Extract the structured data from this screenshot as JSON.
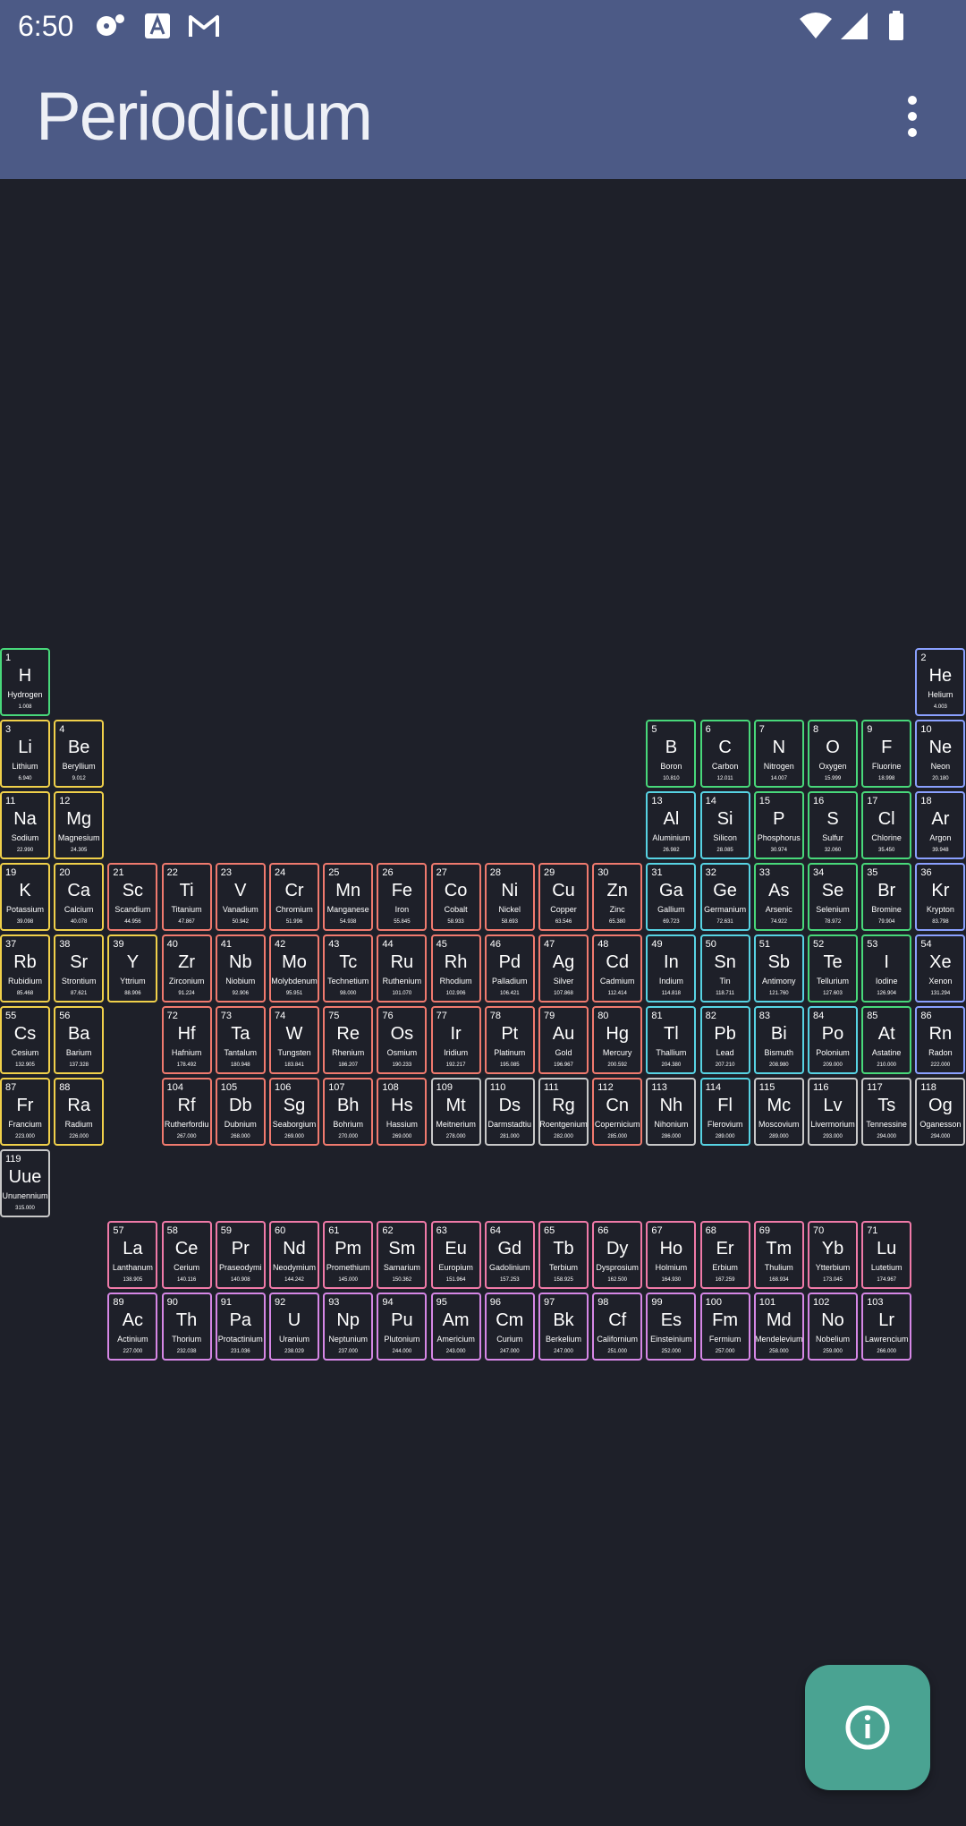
{
  "status_bar": {
    "time": "6:50"
  },
  "app_bar": {
    "title": "Periodicium"
  },
  "colors": {
    "alkali": "#f0d04a",
    "transition": "#f07a6e",
    "unknown": "#c8c8c8",
    "post_transition": "#57d3e3",
    "nonmetal": "#48d87a",
    "noble_gas": "#8aa0ff",
    "lanthanide": "#f07aa8",
    "actinide": "#d687e6"
  },
  "elements": [
    {
      "n": "1",
      "s": "H",
      "name": "Hydrogen",
      "m": "1.008",
      "c": "nonmetal",
      "r": 1,
      "col": 1
    },
    {
      "n": "2",
      "s": "He",
      "name": "Helium",
      "m": "4.003",
      "c": "noble_gas",
      "r": 1,
      "col": 18
    },
    {
      "n": "3",
      "s": "Li",
      "name": "Lithium",
      "m": "6.940",
      "c": "alkali",
      "r": 2,
      "col": 1
    },
    {
      "n": "4",
      "s": "Be",
      "name": "Beryllium",
      "m": "9.012",
      "c": "alkali",
      "r": 2,
      "col": 2
    },
    {
      "n": "5",
      "s": "B",
      "name": "Boron",
      "m": "10.810",
      "c": "nonmetal",
      "r": 2,
      "col": 13
    },
    {
      "n": "6",
      "s": "C",
      "name": "Carbon",
      "m": "12.011",
      "c": "nonmetal",
      "r": 2,
      "col": 14
    },
    {
      "n": "7",
      "s": "N",
      "name": "Nitrogen",
      "m": "14.007",
      "c": "nonmetal",
      "r": 2,
      "col": 15
    },
    {
      "n": "8",
      "s": "O",
      "name": "Oxygen",
      "m": "15.999",
      "c": "nonmetal",
      "r": 2,
      "col": 16
    },
    {
      "n": "9",
      "s": "F",
      "name": "Fluorine",
      "m": "18.998",
      "c": "nonmetal",
      "r": 2,
      "col": 17
    },
    {
      "n": "10",
      "s": "Ne",
      "name": "Neon",
      "m": "20.180",
      "c": "noble_gas",
      "r": 2,
      "col": 18
    },
    {
      "n": "11",
      "s": "Na",
      "name": "Sodium",
      "m": "22.990",
      "c": "alkali",
      "r": 3,
      "col": 1
    },
    {
      "n": "12",
      "s": "Mg",
      "name": "Magnesium",
      "m": "24.305",
      "c": "alkali",
      "r": 3,
      "col": 2
    },
    {
      "n": "13",
      "s": "Al",
      "name": "Aluminium",
      "m": "26.982",
      "c": "post_transition",
      "r": 3,
      "col": 13
    },
    {
      "n": "14",
      "s": "Si",
      "name": "Silicon",
      "m": "28.085",
      "c": "post_transition",
      "r": 3,
      "col": 14
    },
    {
      "n": "15",
      "s": "P",
      "name": "Phosphorus",
      "m": "30.974",
      "c": "nonmetal",
      "r": 3,
      "col": 15
    },
    {
      "n": "16",
      "s": "S",
      "name": "Sulfur",
      "m": "32.060",
      "c": "nonmetal",
      "r": 3,
      "col": 16
    },
    {
      "n": "17",
      "s": "Cl",
      "name": "Chlorine",
      "m": "35.450",
      "c": "nonmetal",
      "r": 3,
      "col": 17
    },
    {
      "n": "18",
      "s": "Ar",
      "name": "Argon",
      "m": "39.948",
      "c": "noble_gas",
      "r": 3,
      "col": 18
    },
    {
      "n": "19",
      "s": "K",
      "name": "Potassium",
      "m": "39.098",
      "c": "alkali",
      "r": 4,
      "col": 1
    },
    {
      "n": "20",
      "s": "Ca",
      "name": "Calcium",
      "m": "40.078",
      "c": "alkali",
      "r": 4,
      "col": 2
    },
    {
      "n": "21",
      "s": "Sc",
      "name": "Scandium",
      "m": "44.956",
      "c": "transition",
      "r": 4,
      "col": 3
    },
    {
      "n": "22",
      "s": "Ti",
      "name": "Titanium",
      "m": "47.867",
      "c": "transition",
      "r": 4,
      "col": 4
    },
    {
      "n": "23",
      "s": "V",
      "name": "Vanadium",
      "m": "50.942",
      "c": "transition",
      "r": 4,
      "col": 5
    },
    {
      "n": "24",
      "s": "Cr",
      "name": "Chromium",
      "m": "51.996",
      "c": "transition",
      "r": 4,
      "col": 6
    },
    {
      "n": "25",
      "s": "Mn",
      "name": "Manganese",
      "m": "54.938",
      "c": "transition",
      "r": 4,
      "col": 7
    },
    {
      "n": "26",
      "s": "Fe",
      "name": "Iron",
      "m": "55.845",
      "c": "transition",
      "r": 4,
      "col": 8
    },
    {
      "n": "27",
      "s": "Co",
      "name": "Cobalt",
      "m": "58.933",
      "c": "transition",
      "r": 4,
      "col": 9
    },
    {
      "n": "28",
      "s": "Ni",
      "name": "Nickel",
      "m": "58.693",
      "c": "transition",
      "r": 4,
      "col": 10
    },
    {
      "n": "29",
      "s": "Cu",
      "name": "Copper",
      "m": "63.546",
      "c": "transition",
      "r": 4,
      "col": 11
    },
    {
      "n": "30",
      "s": "Zn",
      "name": "Zinc",
      "m": "65.380",
      "c": "transition",
      "r": 4,
      "col": 12
    },
    {
      "n": "31",
      "s": "Ga",
      "name": "Gallium",
      "m": "69.723",
      "c": "post_transition",
      "r": 4,
      "col": 13
    },
    {
      "n": "32",
      "s": "Ge",
      "name": "Germanium",
      "m": "72.631",
      "c": "post_transition",
      "r": 4,
      "col": 14
    },
    {
      "n": "33",
      "s": "As",
      "name": "Arsenic",
      "m": "74.922",
      "c": "nonmetal",
      "r": 4,
      "col": 15
    },
    {
      "n": "34",
      "s": "Se",
      "name": "Selenium",
      "m": "78.972",
      "c": "nonmetal",
      "r": 4,
      "col": 16
    },
    {
      "n": "35",
      "s": "Br",
      "name": "Bromine",
      "m": "79.904",
      "c": "nonmetal",
      "r": 4,
      "col": 17
    },
    {
      "n": "36",
      "s": "Kr",
      "name": "Krypton",
      "m": "83.798",
      "c": "noble_gas",
      "r": 4,
      "col": 18
    },
    {
      "n": "37",
      "s": "Rb",
      "name": "Rubidium",
      "m": "85.468",
      "c": "alkali",
      "r": 5,
      "col": 1
    },
    {
      "n": "38",
      "s": "Sr",
      "name": "Strontium",
      "m": "87.621",
      "c": "alkali",
      "r": 5,
      "col": 2
    },
    {
      "n": "39",
      "s": "Y",
      "name": "Yttrium",
      "m": "88.906",
      "c": "alkali",
      "r": 5,
      "col": 3
    },
    {
      "n": "40",
      "s": "Zr",
      "name": "Zirconium",
      "m": "91.224",
      "c": "transition",
      "r": 5,
      "col": 4
    },
    {
      "n": "41",
      "s": "Nb",
      "name": "Niobium",
      "m": "92.906",
      "c": "transition",
      "r": 5,
      "col": 5
    },
    {
      "n": "42",
      "s": "Mo",
      "name": "Molybdenum",
      "m": "95.951",
      "c": "transition",
      "r": 5,
      "col": 6
    },
    {
      "n": "43",
      "s": "Tc",
      "name": "Technetium",
      "m": "98.000",
      "c": "transition",
      "r": 5,
      "col": 7
    },
    {
      "n": "44",
      "s": "Ru",
      "name": "Ruthenium",
      "m": "101.070",
      "c": "transition",
      "r": 5,
      "col": 8
    },
    {
      "n": "45",
      "s": "Rh",
      "name": "Rhodium",
      "m": "102.906",
      "c": "transition",
      "r": 5,
      "col": 9
    },
    {
      "n": "46",
      "s": "Pd",
      "name": "Palladium",
      "m": "106.421",
      "c": "transition",
      "r": 5,
      "col": 10
    },
    {
      "n": "47",
      "s": "Ag",
      "name": "Silver",
      "m": "107.868",
      "c": "transition",
      "r": 5,
      "col": 11
    },
    {
      "n": "48",
      "s": "Cd",
      "name": "Cadmium",
      "m": "112.414",
      "c": "transition",
      "r": 5,
      "col": 12
    },
    {
      "n": "49",
      "s": "In",
      "name": "Indium",
      "m": "114.818",
      "c": "post_transition",
      "r": 5,
      "col": 13
    },
    {
      "n": "50",
      "s": "Sn",
      "name": "Tin",
      "m": "118.711",
      "c": "post_transition",
      "r": 5,
      "col": 14
    },
    {
      "n": "51",
      "s": "Sb",
      "name": "Antimony",
      "m": "121.760",
      "c": "post_transition",
      "r": 5,
      "col": 15
    },
    {
      "n": "52",
      "s": "Te",
      "name": "Tellurium",
      "m": "127.603",
      "c": "nonmetal",
      "r": 5,
      "col": 16
    },
    {
      "n": "53",
      "s": "I",
      "name": "Iodine",
      "m": "126.904",
      "c": "nonmetal",
      "r": 5,
      "col": 17
    },
    {
      "n": "54",
      "s": "Xe",
      "name": "Xenon",
      "m": "131.294",
      "c": "noble_gas",
      "r": 5,
      "col": 18
    },
    {
      "n": "55",
      "s": "Cs",
      "name": "Cesium",
      "m": "132.905",
      "c": "alkali",
      "r": 6,
      "col": 1
    },
    {
      "n": "56",
      "s": "Ba",
      "name": "Barium",
      "m": "137.328",
      "c": "alkali",
      "r": 6,
      "col": 2
    },
    {
      "n": "72",
      "s": "Hf",
      "name": "Hafnium",
      "m": "178.492",
      "c": "transition",
      "r": 6,
      "col": 4
    },
    {
      "n": "73",
      "s": "Ta",
      "name": "Tantalum",
      "m": "180.948",
      "c": "transition",
      "r": 6,
      "col": 5
    },
    {
      "n": "74",
      "s": "W",
      "name": "Tungsten",
      "m": "183.841",
      "c": "transition",
      "r": 6,
      "col": 6
    },
    {
      "n": "75",
      "s": "Re",
      "name": "Rhenium",
      "m": "186.207",
      "c": "transition",
      "r": 6,
      "col": 7
    },
    {
      "n": "76",
      "s": "Os",
      "name": "Osmium",
      "m": "190.233",
      "c": "transition",
      "r": 6,
      "col": 8
    },
    {
      "n": "77",
      "s": "Ir",
      "name": "Iridium",
      "m": "192.217",
      "c": "transition",
      "r": 6,
      "col": 9
    },
    {
      "n": "78",
      "s": "Pt",
      "name": "Platinum",
      "m": "195.085",
      "c": "transition",
      "r": 6,
      "col": 10
    },
    {
      "n": "79",
      "s": "Au",
      "name": "Gold",
      "m": "196.967",
      "c": "transition",
      "r": 6,
      "col": 11
    },
    {
      "n": "80",
      "s": "Hg",
      "name": "Mercury",
      "m": "200.592",
      "c": "transition",
      "r": 6,
      "col": 12
    },
    {
      "n": "81",
      "s": "Tl",
      "name": "Thallium",
      "m": "204.380",
      "c": "post_transition",
      "r": 6,
      "col": 13
    },
    {
      "n": "82",
      "s": "Pb",
      "name": "Lead",
      "m": "207.210",
      "c": "post_transition",
      "r": 6,
      "col": 14
    },
    {
      "n": "83",
      "s": "Bi",
      "name": "Bismuth",
      "m": "208.980",
      "c": "post_transition",
      "r": 6,
      "col": 15
    },
    {
      "n": "84",
      "s": "Po",
      "name": "Polonium",
      "m": "209.000",
      "c": "post_transition",
      "r": 6,
      "col": 16
    },
    {
      "n": "85",
      "s": "At",
      "name": "Astatine",
      "m": "210.000",
      "c": "nonmetal",
      "r": 6,
      "col": 17
    },
    {
      "n": "86",
      "s": "Rn",
      "name": "Radon",
      "m": "222.000",
      "c": "noble_gas",
      "r": 6,
      "col": 18
    },
    {
      "n": "87",
      "s": "Fr",
      "name": "Francium",
      "m": "223.000",
      "c": "alkali",
      "r": 7,
      "col": 1
    },
    {
      "n": "88",
      "s": "Ra",
      "name": "Radium",
      "m": "226.000",
      "c": "alkali",
      "r": 7,
      "col": 2
    },
    {
      "n": "104",
      "s": "Rf",
      "name": "Rutherfordiu",
      "m": "267.000",
      "c": "transition",
      "r": 7,
      "col": 4
    },
    {
      "n": "105",
      "s": "Db",
      "name": "Dubnium",
      "m": "268.000",
      "c": "transition",
      "r": 7,
      "col": 5
    },
    {
      "n": "106",
      "s": "Sg",
      "name": "Seaborgium",
      "m": "269.000",
      "c": "transition",
      "r": 7,
      "col": 6
    },
    {
      "n": "107",
      "s": "Bh",
      "name": "Bohrium",
      "m": "270.000",
      "c": "transition",
      "r": 7,
      "col": 7
    },
    {
      "n": "108",
      "s": "Hs",
      "name": "Hassium",
      "m": "269.000",
      "c": "transition",
      "r": 7,
      "col": 8
    },
    {
      "n": "109",
      "s": "Mt",
      "name": "Meitnerium",
      "m": "278.000",
      "c": "unknown",
      "r": 7,
      "col": 9
    },
    {
      "n": "110",
      "s": "Ds",
      "name": "Darmstadtiu",
      "m": "281.000",
      "c": "unknown",
      "r": 7,
      "col": 10
    },
    {
      "n": "111",
      "s": "Rg",
      "name": "Roentgenium",
      "m": "282.000",
      "c": "unknown",
      "r": 7,
      "col": 11
    },
    {
      "n": "112",
      "s": "Cn",
      "name": "Copernicium",
      "m": "285.000",
      "c": "transition",
      "r": 7,
      "col": 12
    },
    {
      "n": "113",
      "s": "Nh",
      "name": "Nihonium",
      "m": "286.000",
      "c": "unknown",
      "r": 7,
      "col": 13
    },
    {
      "n": "114",
      "s": "Fl",
      "name": "Flerovium",
      "m": "289.000",
      "c": "post_transition",
      "r": 7,
      "col": 14
    },
    {
      "n": "115",
      "s": "Mc",
      "name": "Moscovium",
      "m": "289.000",
      "c": "unknown",
      "r": 7,
      "col": 15
    },
    {
      "n": "116",
      "s": "Lv",
      "name": "Livermorium",
      "m": "293.000",
      "c": "unknown",
      "r": 7,
      "col": 16
    },
    {
      "n": "117",
      "s": "Ts",
      "name": "Tennessine",
      "m": "294.000",
      "c": "unknown",
      "r": 7,
      "col": 17
    },
    {
      "n": "118",
      "s": "Og",
      "name": "Oganesson",
      "m": "294.000",
      "c": "unknown",
      "r": 7,
      "col": 18
    },
    {
      "n": "119",
      "s": "Uue",
      "name": "Ununennium",
      "m": "315.000",
      "c": "unknown",
      "r": 8,
      "col": 1
    },
    {
      "n": "57",
      "s": "La",
      "name": "Lanthanum",
      "m": "138.905",
      "c": "lanthanide",
      "r": 9,
      "col": 3
    },
    {
      "n": "58",
      "s": "Ce",
      "name": "Cerium",
      "m": "140.116",
      "c": "lanthanide",
      "r": 9,
      "col": 4
    },
    {
      "n": "59",
      "s": "Pr",
      "name": "Praseodymi",
      "m": "140.908",
      "c": "lanthanide",
      "r": 9,
      "col": 5
    },
    {
      "n": "60",
      "s": "Nd",
      "name": "Neodymium",
      "m": "144.242",
      "c": "lanthanide",
      "r": 9,
      "col": 6
    },
    {
      "n": "61",
      "s": "Pm",
      "name": "Promethium",
      "m": "145.000",
      "c": "lanthanide",
      "r": 9,
      "col": 7
    },
    {
      "n": "62",
      "s": "Sm",
      "name": "Samarium",
      "m": "150.362",
      "c": "lanthanide",
      "r": 9,
      "col": 8
    },
    {
      "n": "63",
      "s": "Eu",
      "name": "Europium",
      "m": "151.964",
      "c": "lanthanide",
      "r": 9,
      "col": 9
    },
    {
      "n": "64",
      "s": "Gd",
      "name": "Gadolinium",
      "m": "157.253",
      "c": "lanthanide",
      "r": 9,
      "col": 10
    },
    {
      "n": "65",
      "s": "Tb",
      "name": "Terbium",
      "m": "158.925",
      "c": "lanthanide",
      "r": 9,
      "col": 11
    },
    {
      "n": "66",
      "s": "Dy",
      "name": "Dysprosium",
      "m": "162.500",
      "c": "lanthanide",
      "r": 9,
      "col": 12
    },
    {
      "n": "67",
      "s": "Ho",
      "name": "Holmium",
      "m": "164.930",
      "c": "lanthanide",
      "r": 9,
      "col": 13
    },
    {
      "n": "68",
      "s": "Er",
      "name": "Erbium",
      "m": "167.259",
      "c": "lanthanide",
      "r": 9,
      "col": 14
    },
    {
      "n": "69",
      "s": "Tm",
      "name": "Thulium",
      "m": "168.934",
      "c": "lanthanide",
      "r": 9,
      "col": 15
    },
    {
      "n": "70",
      "s": "Yb",
      "name": "Ytterbium",
      "m": "173.045",
      "c": "lanthanide",
      "r": 9,
      "col": 16
    },
    {
      "n": "71",
      "s": "Lu",
      "name": "Lutetium",
      "m": "174.967",
      "c": "lanthanide",
      "r": 9,
      "col": 17
    },
    {
      "n": "89",
      "s": "Ac",
      "name": "Actinium",
      "m": "227.000",
      "c": "actinide",
      "r": 10,
      "col": 3
    },
    {
      "n": "90",
      "s": "Th",
      "name": "Thorium",
      "m": "232.038",
      "c": "actinide",
      "r": 10,
      "col": 4
    },
    {
      "n": "91",
      "s": "Pa",
      "name": "Protactinium",
      "m": "231.036",
      "c": "actinide",
      "r": 10,
      "col": 5
    },
    {
      "n": "92",
      "s": "U",
      "name": "Uranium",
      "m": "238.029",
      "c": "actinide",
      "r": 10,
      "col": 6
    },
    {
      "n": "93",
      "s": "Np",
      "name": "Neptunium",
      "m": "237.000",
      "c": "actinide",
      "r": 10,
      "col": 7
    },
    {
      "n": "94",
      "s": "Pu",
      "name": "Plutonium",
      "m": "244.000",
      "c": "actinide",
      "r": 10,
      "col": 8
    },
    {
      "n": "95",
      "s": "Am",
      "name": "Americium",
      "m": "243.000",
      "c": "actinide",
      "r": 10,
      "col": 9
    },
    {
      "n": "96",
      "s": "Cm",
      "name": "Curium",
      "m": "247.000",
      "c": "actinide",
      "r": 10,
      "col": 10
    },
    {
      "n": "97",
      "s": "Bk",
      "name": "Berkelium",
      "m": "247.000",
      "c": "actinide",
      "r": 10,
      "col": 11
    },
    {
      "n": "98",
      "s": "Cf",
      "name": "Californium",
      "m": "251.000",
      "c": "actinide",
      "r": 10,
      "col": 12
    },
    {
      "n": "99",
      "s": "Es",
      "name": "Einsteinium",
      "m": "252.000",
      "c": "actinide",
      "r": 10,
      "col": 13
    },
    {
      "n": "100",
      "s": "Fm",
      "name": "Fermium",
      "m": "257.000",
      "c": "actinide",
      "r": 10,
      "col": 14
    },
    {
      "n": "101",
      "s": "Md",
      "name": "Mendelevium",
      "m": "258.000",
      "c": "actinide",
      "r": 10,
      "col": 15
    },
    {
      "n": "102",
      "s": "No",
      "name": "Nobelium",
      "m": "259.000",
      "c": "actinide",
      "r": 10,
      "col": 16
    },
    {
      "n": "103",
      "s": "Lr",
      "name": "Lawrencium",
      "m": "266.000",
      "c": "actinide",
      "r": 10,
      "col": 17
    }
  ],
  "fab": {
    "icon": "info-icon"
  }
}
